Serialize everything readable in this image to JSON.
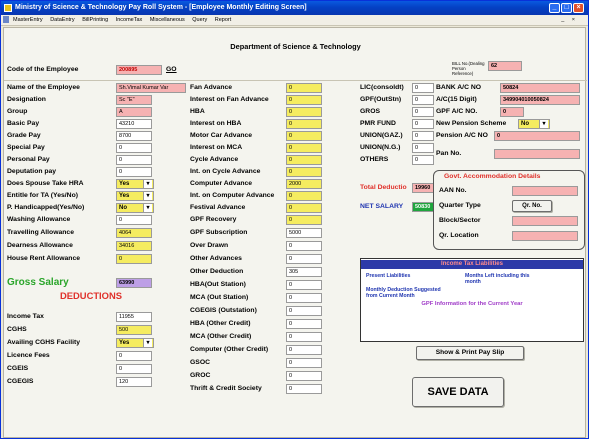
{
  "window": {
    "title": "Ministry of Science & Technology Pay Roll System - [Employee Monthly Editing Screen]",
    "menu": [
      "MasterEntry",
      "DataEntry",
      "BillPrinting",
      "IncomeTax",
      "Miscellaneous",
      "Query",
      "Report"
    ],
    "mdi_controls": "_ ×",
    "minimize": "_",
    "maximize": "□",
    "close": "×"
  },
  "header": {
    "department": "Department of Science & Technology",
    "code_label": "Code of the Employee",
    "code_value": "200895",
    "go_label": "GO",
    "bill_label": "BILL No.(Dealing Person Reference)",
    "bill_value": "62"
  },
  "col1": {
    "name_label": "Name of the Employee",
    "name_value": "Sh.Vimal Kumar Var",
    "designation_label": "Designation",
    "designation_value": "Sc \"E\"",
    "group_label": "Group",
    "group_value": "A",
    "basic_label": "Basic Pay",
    "basic_value": "43210",
    "grade_label": "Grade Pay",
    "grade_value": "8700",
    "special_label": "Special Pay",
    "special_value": "0",
    "personal_label": "Personal Pay",
    "personal_value": "0",
    "deputation_label": "Deputation pay",
    "deputation_value": "0",
    "spouse_hra_label": "Does Spouse Take HRA",
    "spouse_hra_value": "Yes",
    "ta_label": "Entitle for TA (Yes/No)",
    "ta_value": "Yes",
    "handicapped_label": "P. Handicapped(Yes/No)",
    "handicapped_value": "No",
    "washing_label": "Washing Allowance",
    "washing_value": "0",
    "travelling_label": "Travelling Allowance",
    "travelling_value": "4064",
    "dearness_label": "Dearness Allowance",
    "dearness_value": "34016",
    "hra_label": "House Rent Allowance",
    "hra_value": "0",
    "gross_label": "Gross Salary",
    "gross_value": "63990",
    "deductions_label": "DEDUCTIONS",
    "income_tax_label": "Income Tax",
    "income_tax_value": "11955",
    "cghs_label": "CGHS",
    "cghs_value": "500",
    "avail_cghs_label": "Availing CGHS Facility",
    "avail_cghs_value": "Yes",
    "licence_label": "Licence Fees",
    "licence_value": "0",
    "cgeis_label": "CGEIS",
    "cgeis_value": "0",
    "cgegis_label": "CGEGIS",
    "cgegis_value": "120"
  },
  "col2": {
    "fan_adv_label": "Fan Advance",
    "fan_adv_value": "0",
    "int_fan_label": "Interest on Fan Advance",
    "int_fan_value": "0",
    "hba_label": "HBA",
    "hba_value": "0",
    "int_hba_label": "Interest on HBA",
    "int_hba_value": "0",
    "mca_label": "Motor Car Advance",
    "mca_value": "0",
    "int_mca_label": "Interest on MCA",
    "int_mca_value": "0",
    "cycle_label": "Cycle Advance",
    "cycle_value": "0",
    "int_cycle_label": "Int. on Cycle Advance",
    "int_cycle_value": "0",
    "computer_label": "Computer Advance",
    "computer_value": "2000",
    "int_computer_label": "Int. on Computer Advance",
    "int_computer_value": "0",
    "festival_label": "Festival Advance",
    "festival_value": "0",
    "gpf_rec_label": "GPF Recovery",
    "gpf_rec_value": "0",
    "gpf_sub_label": "GPF Subscription",
    "gpf_sub_value": "5000",
    "over_drawn_label": "Over Drawn",
    "over_drawn_value": "0",
    "other_adv_label": "Other Advances",
    "other_adv_value": "0",
    "other_ded_label": "Other Deduction",
    "other_ded_value": "305",
    "hba_out_label": "HBA(Out Station)",
    "hba_out_value": "0",
    "mca_out_label": "MCA (Out Station)",
    "mca_out_value": "0",
    "cgegis_out_label": "CGEGIS (Outstation)",
    "cgegis_out_value": "0",
    "hba_credit_label": "HBA (Other Credit)",
    "hba_credit_value": "0",
    "mca_credit_label": "MCA (Other Credit)",
    "mca_credit_value": "0",
    "computer_credit_label": "Computer (Other Credit)",
    "computer_credit_value": "0",
    "gsoc_label": "GSOC",
    "gsoc_value": "0",
    "groc_label": "GROC",
    "groc_value": "0",
    "thrift_label": "Thrift & Credit Society",
    "thrift_value": "0"
  },
  "col3": {
    "lic_label": "LIC(consoldt)",
    "lic_value": "0",
    "gpf_out_label": "GPF(OutStn)",
    "gpf_out_value": "0",
    "gros_label": "GROS",
    "gros_value": "0",
    "pmr_label": "PMR FUND",
    "pmr_value": "0",
    "union_gaz_label": "UNION(GAZ.)",
    "union_gaz_value": "0",
    "union_ng_label": "UNION(N.G.)",
    "union_ng_value": "0",
    "others_label": "OTHERS",
    "others_value": "0",
    "total_ded_label": "Total Deductio",
    "total_ded_value": "19960",
    "net_label": "NET SALARY",
    "net_value": "50830"
  },
  "col4": {
    "bank_label": "BANK A/C NO",
    "bank_value": "50824",
    "ac15_label": "A/C(15 Digit)",
    "ac15_value": "349904010050824",
    "gpf_ac_label": "GPF A/C NO.",
    "gpf_ac_value": "0",
    "new_pension_label": "New Pension Scheme",
    "new_pension_value": "No",
    "pension_ac_label": "Pension A/C NO",
    "pension_ac_value": "0",
    "pan_label": "Pan No.",
    "pan_value": ""
  },
  "gov_accom": {
    "title": "Govt. Accommodation Details",
    "aan_label": "AAN No.",
    "aan_value": "",
    "quarter_label": "Quarter Type",
    "qr_button": "Qr. No.",
    "block_label": "Block/Sector",
    "block_value": "",
    "location_label": "Qr. Location",
    "location_value": ""
  },
  "income_tax": {
    "title": "Income Tax Liabilities",
    "present": "Present Liabilities",
    "months_left": "Months Left including this month",
    "monthly_ded": "Monthly Deduction Suggested from Current Month",
    "gpf_info": "GPF Information for the Current Year"
  },
  "actions": {
    "show_print": "Show & Print Pay Slip",
    "save": "SAVE DATA"
  },
  "colors": {
    "pink_field": "#f6b2b2",
    "yellow_field": "#f5ec60",
    "purple_field": "#bd9fe6",
    "green_field": "#1fa53d",
    "title_bar": "#0441c4",
    "gross_label": "#2aa52a",
    "deductions_label": "#e0302a"
  }
}
